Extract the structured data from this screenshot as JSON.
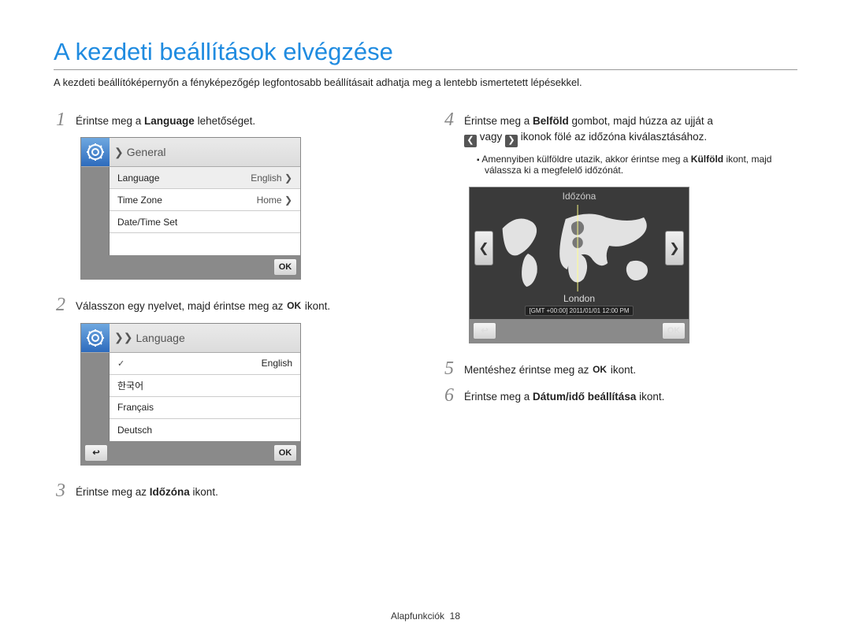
{
  "title": "A kezdeti beállítások elvégzése",
  "intro": "A kezdeti beállítóképernyőn a fényképezőgép legfontosabb beállításait adhatja meg a lentebb ismertetett lépésekkel.",
  "steps": {
    "s1": {
      "num": "1",
      "pre": "Érintse meg a ",
      "bold": "Language",
      "post": " lehetőséget."
    },
    "s2": {
      "num": "2",
      "pre": "Válasszon egy nyelvet, majd érintse meg az ",
      "post": " ikont."
    },
    "s3": {
      "num": "3",
      "pre": "Érintse meg az ",
      "bold": "Időzóna",
      "post": " ikont."
    },
    "s4": {
      "num": "4",
      "line1_pre": "Érintse meg a ",
      "line1_bold": "Belföld",
      "line1_post": " gombot, majd húzza az ujját a",
      "line2_mid": " vagy ",
      "line2_end": " ikonok fölé az időzóna kiválasztásához.",
      "note_pre": "Amennyiben külföldre utazik, akkor érintse meg a ",
      "note_bold": "Külföld",
      "note_post": " ikont, majd válassza ki a megfelelő időzónát."
    },
    "s5": {
      "num": "5",
      "pre": "Mentéshez érintse meg az ",
      "post": " ikont."
    },
    "s6": {
      "num": "6",
      "pre": "Érintse meg a ",
      "bold": "Dátum/idő beállítása",
      "post": " ikont."
    }
  },
  "general_panel": {
    "crumb": "General",
    "rows": [
      {
        "label": "Language",
        "value": "English"
      },
      {
        "label": "Time Zone",
        "value": "Home"
      },
      {
        "label": "Date/Time Set",
        "value": ""
      }
    ],
    "ok": "OK"
  },
  "language_panel": {
    "crumb": "Language",
    "options": [
      "English",
      "한국어",
      "Français",
      "Deutsch"
    ],
    "selected": "English",
    "ok": "OK"
  },
  "timezone_panel": {
    "title": "Időzóna",
    "city": "London",
    "gmt": "[GMT +00:00] 2011/01/01 12:00 PM",
    "ok": "OK"
  },
  "ok_glyph": "OK",
  "footer": {
    "label": "Alapfunkciók",
    "page": "18"
  }
}
